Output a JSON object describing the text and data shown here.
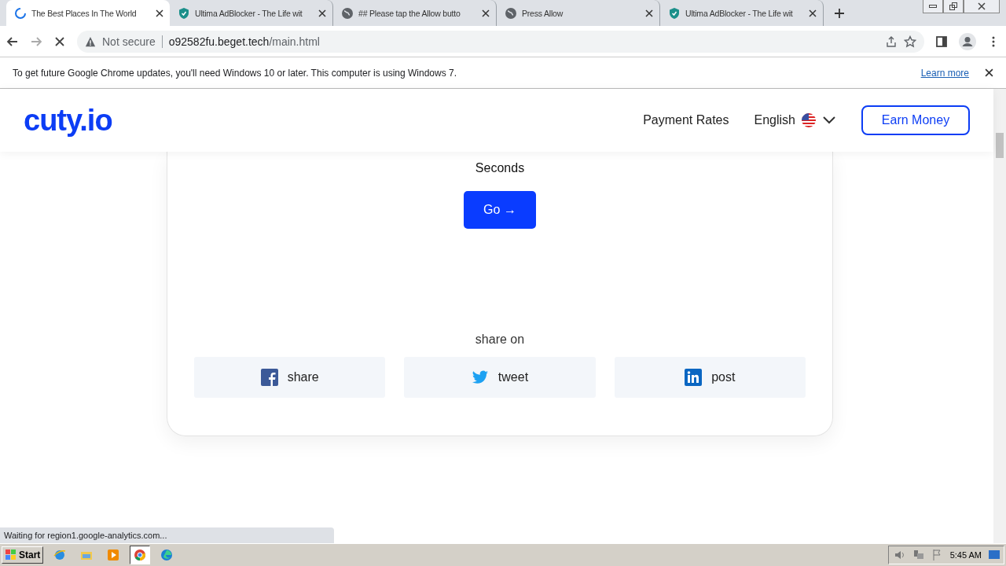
{
  "tabs": [
    {
      "title": "The Best Places In The World",
      "kind": "loading",
      "selected": true
    },
    {
      "title": "Ultima AdBlocker - The Life wit",
      "kind": "extension",
      "selected": false
    },
    {
      "title": "## Please tap the Allow butto",
      "kind": "site",
      "selected": false
    },
    {
      "title": "Press Allow",
      "kind": "site",
      "selected": false
    },
    {
      "title": "Ultima AdBlocker - The Life wit",
      "kind": "extension",
      "selected": false
    }
  ],
  "toolbar": {
    "security": "Not secure",
    "url_host": "o92582fu.beget.tech",
    "url_path": "/main.html",
    "loading": true
  },
  "infobar": {
    "message": "To get future Google Chrome updates, you'll need Windows 10 or later. This computer is using Windows 7.",
    "link": "Learn more"
  },
  "site_header": {
    "logo": "cuty.io",
    "nav": "Payment Rates",
    "language": "English",
    "cta": "Earn Money"
  },
  "card": {
    "countdown_label": "Seconds",
    "go_button": "Go →",
    "share_title": "share on",
    "share_buttons": [
      {
        "kind": "facebook",
        "label": "share"
      },
      {
        "kind": "twitter",
        "label": "tweet"
      },
      {
        "kind": "linkedin",
        "label": "post"
      }
    ]
  },
  "status_bubble": "Waiting for region1.google-analytics.com...",
  "taskbar": {
    "start": "Start",
    "apps": [
      {
        "kind": "ie",
        "selected": false
      },
      {
        "kind": "explorer",
        "selected": false
      },
      {
        "kind": "media",
        "selected": false
      },
      {
        "kind": "chrome",
        "selected": true
      },
      {
        "kind": "edge",
        "selected": false
      }
    ],
    "clock": "5:45 AM"
  }
}
